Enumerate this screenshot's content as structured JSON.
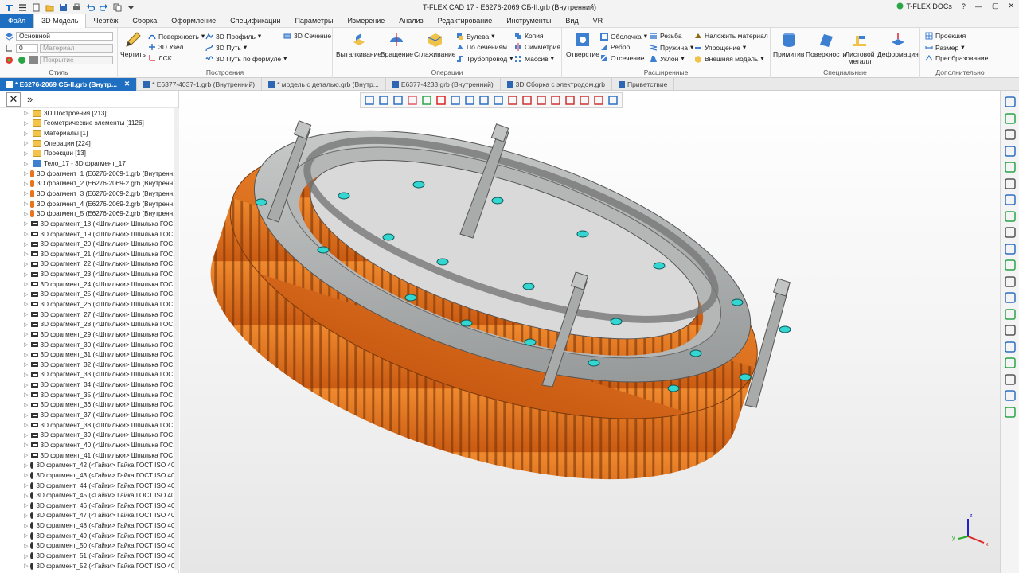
{
  "window": {
    "title": "T-FLEX CAD 17 - E6276-2069 СБ-II.grb (Внутренний)",
    "docs_label": "T-FLEX DOCs"
  },
  "menu": {
    "file": "Файл",
    "tabs": [
      "3D Модель",
      "Чертёж",
      "Сборка",
      "Оформление",
      "Спецификации",
      "Параметры",
      "Измерение",
      "Анализ",
      "Редактирование",
      "Инструменты",
      "Вид",
      "VR"
    ]
  },
  "ribbon": {
    "style": {
      "layer": "Основной",
      "level": "0",
      "material": "Материал",
      "coating": "Покрытие",
      "caption": "Стиль"
    },
    "build": {
      "sketch": "Чертить",
      "surface": "Поверхность",
      "node3d": "3D Узел",
      "lcs": "ЛСК",
      "profile3d": "3D Профиль",
      "path3d": "3D Путь",
      "path_formula": "3D Путь по формуле",
      "section3d": "3D Сечение",
      "caption": "Построения"
    },
    "ops": {
      "extrude": "Выталкивание",
      "rotate": "Вращение",
      "smooth": "Сглаживание",
      "boolean": "Булева",
      "by_sections": "По сечениям",
      "pipe": "Трубопровод",
      "copy": "Копия",
      "symmetry": "Симметрия",
      "array": "Массив",
      "caption": "Операции"
    },
    "ext": {
      "hole": "Отверстие",
      "shell": "Оболочка",
      "rib": "Ребро",
      "cut": "Отсечение",
      "thread": "Резьба",
      "spring": "Пружина",
      "slope": "Уклон",
      "apply_material": "Наложить материал",
      "simplify": "Упрощение",
      "ext_model": "Внешняя модель",
      "caption": "Расширенные"
    },
    "spec": {
      "primitive": "Примитив",
      "surfaces": "Поверхности",
      "sheet_metal": "Листовой металл",
      "deformation": "Деформация",
      "caption": "Специальные"
    },
    "extra": {
      "projection": "Проекция",
      "size": "Размер",
      "transform": "Преобразование",
      "caption": "Дополнительно"
    }
  },
  "doc_tabs": [
    {
      "label": "* E6276-2069 СБ-II.grb (Внутр...",
      "active": true
    },
    {
      "label": "* E6377-4037-1.grb (Внутренний)",
      "active": false
    },
    {
      "label": "* модель с деталью.grb (Внутр...",
      "active": false
    },
    {
      "label": "E6377-4233.grb (Внутренний)",
      "active": false
    },
    {
      "label": "3D Сборка с электродом.grb",
      "active": false
    },
    {
      "label": "Приветствие",
      "active": false
    }
  ],
  "tree": {
    "items": [
      {
        "label": "3D Построения [213]",
        "icon": "folder"
      },
      {
        "label": "Геометрические элементы [1126]",
        "icon": "folder"
      },
      {
        "label": "Материалы [1]",
        "icon": "folder"
      },
      {
        "label": "Операции [224]",
        "icon": "folder"
      },
      {
        "label": "Проекции [13]",
        "icon": "folder"
      },
      {
        "label": "Тело_17 - 3D фрагмент_17",
        "icon": "body"
      },
      {
        "label": "3D фрагмент_1 (E6276-2069-1.grb (Внутренн...",
        "icon": "frag"
      },
      {
        "label": "3D фрагмент_2 (E6276-2069-2.grb (Внутренн...",
        "icon": "frag"
      },
      {
        "label": "3D фрагмент_3 (E6276-2069-2.grb (Внутренн...",
        "icon": "frag"
      },
      {
        "label": "3D фрагмент_4 (E6276-2069-2.grb (Внутренн...",
        "icon": "frag"
      },
      {
        "label": "3D фрагмент_5 (E6276-2069-2.grb (Внутренн...",
        "icon": "frag"
      },
      {
        "label": "3D фрагмент_18 (<Шпильки> Шпилька ГОС...",
        "icon": "stud"
      },
      {
        "label": "3D фрагмент_19 (<Шпильки> Шпилька ГОС...",
        "icon": "stud"
      },
      {
        "label": "3D фрагмент_20 (<Шпильки> Шпилька ГОС...",
        "icon": "stud"
      },
      {
        "label": "3D фрагмент_21 (<Шпильки> Шпилька ГОС...",
        "icon": "stud"
      },
      {
        "label": "3D фрагмент_22 (<Шпильки> Шпилька ГОС...",
        "icon": "stud"
      },
      {
        "label": "3D фрагмент_23 (<Шпильки> Шпилька ГОС...",
        "icon": "stud"
      },
      {
        "label": "3D фрагмент_24 (<Шпильки> Шпилька ГОС...",
        "icon": "stud"
      },
      {
        "label": "3D фрагмент_25 (<Шпильки> Шпилька ГОС...",
        "icon": "stud"
      },
      {
        "label": "3D фрагмент_26 (<Шпильки> Шпилька ГОС...",
        "icon": "stud"
      },
      {
        "label": "3D фрагмент_27 (<Шпильки> Шпилька ГОС...",
        "icon": "stud"
      },
      {
        "label": "3D фрагмент_28 (<Шпильки> Шпилька ГОС...",
        "icon": "stud"
      },
      {
        "label": "3D фрагмент_29 (<Шпильки> Шпилька ГОС...",
        "icon": "stud"
      },
      {
        "label": "3D фрагмент_30 (<Шпильки> Шпилька ГОС...",
        "icon": "stud"
      },
      {
        "label": "3D фрагмент_31 (<Шпильки> Шпилька ГОС...",
        "icon": "stud"
      },
      {
        "label": "3D фрагмент_32 (<Шпильки> Шпилька ГОС...",
        "icon": "stud"
      },
      {
        "label": "3D фрагмент_33 (<Шпильки> Шпилька ГОС...",
        "icon": "stud"
      },
      {
        "label": "3D фрагмент_34 (<Шпильки> Шпилька ГОС...",
        "icon": "stud"
      },
      {
        "label": "3D фрагмент_35 (<Шпильки> Шпилька ГОС...",
        "icon": "stud"
      },
      {
        "label": "3D фрагмент_36 (<Шпильки> Шпилька ГОС...",
        "icon": "stud"
      },
      {
        "label": "3D фрагмент_37 (<Шпильки> Шпилька ГОС...",
        "icon": "stud"
      },
      {
        "label": "3D фрагмент_38 (<Шпильки> Шпилька ГОС...",
        "icon": "stud"
      },
      {
        "label": "3D фрагмент_39 (<Шпильки> Шпилька ГОС...",
        "icon": "stud"
      },
      {
        "label": "3D фрагмент_40 (<Шпильки> Шпилька ГОС...",
        "icon": "stud"
      },
      {
        "label": "3D фрагмент_41 (<Шпильки> Шпилька ГОС...",
        "icon": "stud"
      },
      {
        "label": "3D фрагмент_42 (<Гайки> Гайка ГОСТ ISO 40...",
        "icon": "nut"
      },
      {
        "label": "3D фрагмент_43 (<Гайки> Гайка ГОСТ ISO 40...",
        "icon": "nut"
      },
      {
        "label": "3D фрагмент_44 (<Гайки> Гайка ГОСТ ISO 40...",
        "icon": "nut"
      },
      {
        "label": "3D фрагмент_45 (<Гайки> Гайка ГОСТ ISO 40...",
        "icon": "nut"
      },
      {
        "label": "3D фрагмент_46 (<Гайки> Гайка ГОСТ ISO 40...",
        "icon": "nut"
      },
      {
        "label": "3D фрагмент_47 (<Гайки> Гайка ГОСТ ISO 40...",
        "icon": "nut"
      },
      {
        "label": "3D фрагмент_48 (<Гайки> Гайка ГОСТ ISO 40...",
        "icon": "nut"
      },
      {
        "label": "3D фрагмент_49 (<Гайки> Гайка ГОСТ ISO 40...",
        "icon": "nut"
      },
      {
        "label": "3D фрагмент_50 (<Гайки> Гайка ГОСТ ISO 40...",
        "icon": "nut"
      },
      {
        "label": "3D фрагмент_51 (<Гайки> Гайка ГОСТ ISO 40...",
        "icon": "nut"
      },
      {
        "label": "3D фрагмент_52 (<Гайки> Гайка ГОСТ ISO 40...",
        "icon": "nut"
      }
    ]
  },
  "colors": {
    "accent": "#1e6fc2",
    "part_orange": "#e8741c",
    "part_gray": "#a9abab",
    "highlight_cyan": "#33d6d0"
  },
  "axes": {
    "x": "x",
    "y": "y",
    "z": "z"
  }
}
